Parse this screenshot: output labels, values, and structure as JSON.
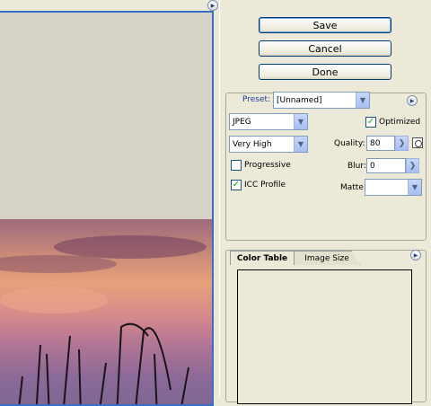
{
  "buttons": {
    "save": "Save",
    "cancel": "Cancel",
    "done": "Done"
  },
  "settings": {
    "preset_label": "Preset:",
    "preset_value": "[Unnamed]",
    "format": "JPEG",
    "optimized_label": "Optimized",
    "optimized_checked": true,
    "quality_preset": "Very High",
    "quality_label": "Quality:",
    "quality_value": "80",
    "progressive_label": "Progressive",
    "progressive_checked": false,
    "blur_label": "Blur:",
    "blur_value": "0",
    "icc_label": "ICC Profile",
    "icc_checked": true,
    "matte_label": "Matte:",
    "matte_value": ""
  },
  "tabs": [
    {
      "label": "Color Table"
    },
    {
      "label": "Image Size"
    }
  ],
  "icons": {
    "flyout": "flyout-menu-icon",
    "dropdown": "chevron-down-icon",
    "stepper": "chevron-right-icon",
    "quality_mask": "mask-icon"
  },
  "colors": {
    "preview_border": "#3a6ec4",
    "check": "#21a121",
    "preset_label": "#1f3d9e"
  }
}
